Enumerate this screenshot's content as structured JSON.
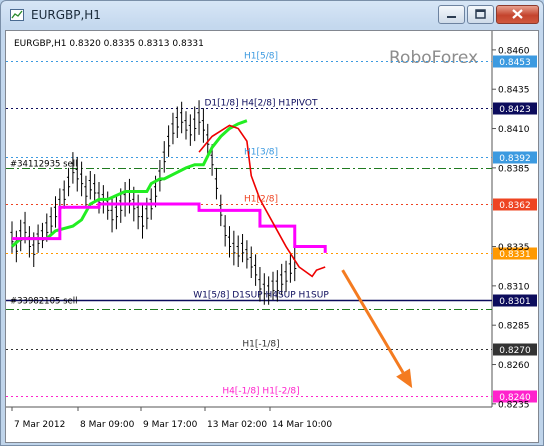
{
  "window": {
    "title": "EURGBP,H1",
    "icon": "chart-window-icon",
    "controls": [
      "minimize-icon",
      "maximize-icon",
      "close-icon"
    ]
  },
  "chart_info": "EURGBP,H1  0.8320 0.8335 0.8313 0.8331",
  "watermark": "RoboForex",
  "chart_data": {
    "type": "line",
    "symbol": "EURGBP",
    "timeframe": "H1",
    "ohlc": {
      "open": 0.832,
      "high": 0.8335,
      "low": 0.8313,
      "close": 0.8331
    },
    "price_ticks": [
      "0.8460",
      "0.8435",
      "0.8410",
      "0.8385",
      "0.8335",
      "0.8310",
      "0.8285",
      "0.8260",
      "0.8235"
    ],
    "time_ticks": [
      "7 Mar 2012",
      "8 Mar 09:00",
      "9 Mar 17:00",
      "13 Mar 02:00",
      "14 Mar 10:00"
    ],
    "ylim": [
      0.8233,
      0.8472
    ],
    "levels": [
      {
        "label": "H1[5/8]",
        "price": 0.8453,
        "tag": "0.8453",
        "color": "#3c9ae0",
        "style": "dotted"
      },
      {
        "label": "D1[1/8] H4[2/8] H1PIVOT",
        "price": 0.8423,
        "tag": "0.8423",
        "color": "#0c0c5c",
        "style": "dotted"
      },
      {
        "label": "H1[3/8]",
        "price": 0.8392,
        "tag": "0.8392",
        "color": "#3c9ae0",
        "style": "dotted"
      },
      {
        "label": "",
        "price": 0.8385,
        "tag": "",
        "color": "#1f7a1f",
        "style": "dashdot"
      },
      {
        "label": "H1[2/8]",
        "price": 0.8362,
        "tag": "0.8362",
        "color": "#ee4422",
        "style": "dotted"
      },
      {
        "label": "",
        "price": 0.8331,
        "tag": "0.8331",
        "color": "#ff9900",
        "style": "dotted"
      },
      {
        "label": "W1[5/8] D1SUP H4SUP H1SUP",
        "price": 0.8301,
        "tag": "0.8301",
        "color": "#0c0c5c",
        "style": "solid"
      },
      {
        "label": "",
        "price": 0.8295,
        "tag": "",
        "color": "#1f7a1f",
        "style": "dashdot"
      },
      {
        "label": "H1[-1/8]",
        "price": 0.827,
        "tag": "0.8270",
        "color": "#333333",
        "style": "dotted"
      },
      {
        "label": "H4[-1/8] H1[-2/8]",
        "price": 0.824,
        "tag": "0.8240",
        "color": "#ff22cc",
        "style": "dotted"
      }
    ],
    "orders": [
      {
        "label": "#34112935 sell",
        "price": 0.8385
      },
      {
        "label": "#33982105 sell",
        "price": 0.8298
      }
    ],
    "series": [
      {
        "name": "",
        "color": "#22ee22",
        "points": [
          [
            0,
            0.8335
          ],
          [
            2,
            0.834
          ],
          [
            8,
            0.834
          ],
          [
            10,
            0.8345
          ],
          [
            14,
            0.8348
          ],
          [
            16,
            0.8352
          ],
          [
            18,
            0.8362
          ],
          [
            20,
            0.8365
          ],
          [
            22,
            0.8365
          ],
          [
            26,
            0.837
          ],
          [
            28,
            0.837
          ],
          [
            31,
            0.837
          ],
          [
            32,
            0.8375
          ],
          [
            34,
            0.8378
          ],
          [
            35,
            0.8378
          ],
          [
            40,
            0.8385
          ],
          [
            42,
            0.8387
          ],
          [
            44,
            0.8387
          ],
          [
            46,
            0.8398
          ],
          [
            48,
            0.8405
          ],
          [
            50,
            0.841
          ],
          [
            52,
            0.8413
          ],
          [
            54,
            0.8415
          ]
        ]
      },
      {
        "name": "",
        "color": "#ff00ff",
        "points": [
          [
            0,
            0.834
          ],
          [
            11,
            0.834
          ],
          [
            11,
            0.836
          ],
          [
            20,
            0.836
          ],
          [
            20,
            0.8362
          ],
          [
            43,
            0.8362
          ],
          [
            43,
            0.8358
          ],
          [
            57,
            0.8358
          ],
          [
            57,
            0.8348
          ],
          [
            65,
            0.8348
          ],
          [
            65,
            0.8335
          ],
          [
            72,
            0.8335
          ],
          [
            72,
            0.8331
          ]
        ]
      },
      {
        "name": "",
        "color": "#ee0000",
        "points": [
          [
            43,
            0.8395
          ],
          [
            46,
            0.8405
          ],
          [
            50,
            0.8412
          ],
          [
            52,
            0.841
          ],
          [
            54,
            0.8402
          ],
          [
            55,
            0.838
          ],
          [
            57,
            0.8365
          ],
          [
            60,
            0.835
          ],
          [
            63,
            0.8335
          ],
          [
            66,
            0.8322
          ],
          [
            69,
            0.8316
          ],
          [
            70,
            0.832
          ],
          [
            72,
            0.8322
          ]
        ]
      }
    ],
    "price_bars": [
      [
        0.8351,
        0.8331
      ],
      [
        0.8345,
        0.8325
      ],
      [
        0.8352,
        0.8332
      ],
      [
        0.8357,
        0.8337
      ],
      [
        0.8348,
        0.8328
      ],
      [
        0.8344,
        0.8322
      ],
      [
        0.8349,
        0.8331
      ],
      [
        0.835,
        0.8334
      ],
      [
        0.8356,
        0.8338
      ],
      [
        0.836,
        0.8342
      ],
      [
        0.8367,
        0.8347
      ],
      [
        0.8372,
        0.8352
      ],
      [
        0.8377,
        0.8359
      ],
      [
        0.8385,
        0.8367
      ],
      [
        0.8395,
        0.8375
      ],
      [
        0.8392,
        0.837
      ],
      [
        0.8389,
        0.8367
      ],
      [
        0.838,
        0.836
      ],
      [
        0.8383,
        0.8365
      ],
      [
        0.8381,
        0.8363
      ],
      [
        0.8376,
        0.8356
      ],
      [
        0.8374,
        0.8356
      ],
      [
        0.837,
        0.8352
      ],
      [
        0.8366,
        0.8344
      ],
      [
        0.8368,
        0.8346
      ],
      [
        0.8372,
        0.835
      ],
      [
        0.8376,
        0.8354
      ],
      [
        0.8378,
        0.8356
      ],
      [
        0.8373,
        0.8351
      ],
      [
        0.8368,
        0.8346
      ],
      [
        0.8362,
        0.834
      ],
      [
        0.8366,
        0.8346
      ],
      [
        0.8372,
        0.8352
      ],
      [
        0.838,
        0.836
      ],
      [
        0.839,
        0.837
      ],
      [
        0.8402,
        0.8382
      ],
      [
        0.8412,
        0.8392
      ],
      [
        0.842,
        0.84
      ],
      [
        0.8424,
        0.8404
      ],
      [
        0.8427,
        0.8407
      ],
      [
        0.8421,
        0.8403
      ],
      [
        0.8419,
        0.8399
      ],
      [
        0.8424,
        0.8402
      ],
      [
        0.8428,
        0.8406
      ],
      [
        0.8423,
        0.8401
      ],
      [
        0.8413,
        0.8393
      ],
      [
        0.84,
        0.838
      ],
      [
        0.8385,
        0.8365
      ],
      [
        0.8368,
        0.8348
      ],
      [
        0.8355,
        0.8335
      ],
      [
        0.8348,
        0.8328
      ],
      [
        0.8345,
        0.8323
      ],
      [
        0.8342,
        0.8322
      ],
      [
        0.8343,
        0.8325
      ],
      [
        0.8339,
        0.8321
      ],
      [
        0.8335,
        0.8315
      ],
      [
        0.833,
        0.831
      ],
      [
        0.8322,
        0.83
      ],
      [
        0.8318,
        0.8298
      ],
      [
        0.8316,
        0.8298
      ],
      [
        0.8319,
        0.8301
      ],
      [
        0.832,
        0.83
      ],
      [
        0.8324,
        0.8304
      ],
      [
        0.8326,
        0.8306
      ],
      [
        0.833,
        0.8312
      ],
      [
        0.8335,
        0.8313
      ]
    ],
    "arrow": {
      "from": [
        76,
        0.832
      ],
      "to": [
        92,
        0.8245
      ],
      "color": "#f47b20"
    }
  }
}
